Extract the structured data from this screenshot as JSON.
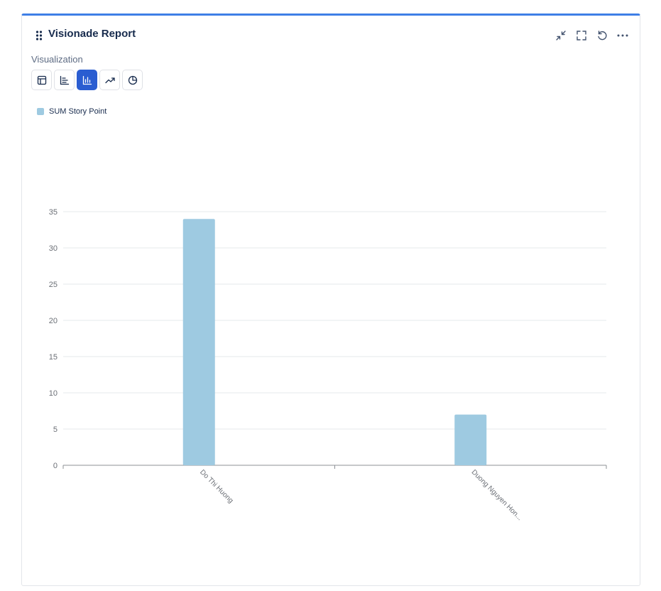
{
  "header": {
    "title": "Visionade Report"
  },
  "visualization": {
    "label": "Visualization",
    "options": [
      {
        "name": "table",
        "active": false
      },
      {
        "name": "horizontal-bar",
        "active": false
      },
      {
        "name": "vertical-bar",
        "active": true
      },
      {
        "name": "line",
        "active": false
      },
      {
        "name": "pie",
        "active": false
      }
    ]
  },
  "colors": {
    "accent": "#3f7fe6",
    "active_button": "#2a5dd1",
    "bar": "#9ecae1"
  },
  "chart_data": {
    "type": "bar",
    "categories": [
      "Do Thi Huong",
      "Duong Nguyen Hon..."
    ],
    "series": [
      {
        "name": "SUM Story Point",
        "values": [
          34,
          7
        ]
      }
    ],
    "ylim": [
      0,
      35
    ],
    "yticks": [
      0,
      5,
      10,
      15,
      20,
      25,
      30,
      35
    ],
    "grid": true,
    "legend_position": "top-left"
  }
}
